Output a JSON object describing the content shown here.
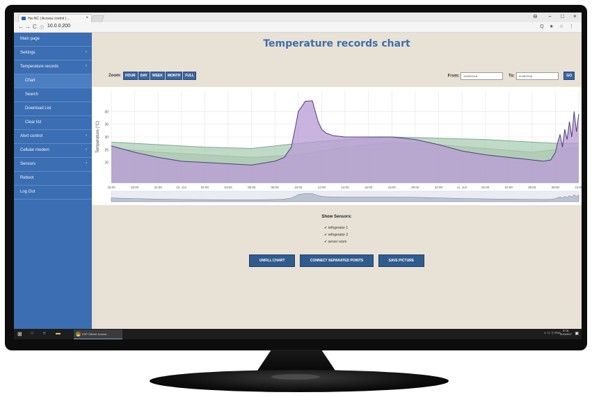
{
  "browser": {
    "tab_title": "Hw-NC | Access control | ...",
    "tab_close": "×",
    "url": "10.0.0.200",
    "nav": {
      "back": "←",
      "forward": "→",
      "reload": "C",
      "info": "ⓘ"
    },
    "window_controls": {
      "account": "⊖",
      "minimize": "−",
      "maximize": "□",
      "close": "×"
    },
    "addr_icons": "Q ★ ☆ ⋮"
  },
  "sidebar": {
    "items": [
      {
        "label": "Main page",
        "chevron": ""
      },
      {
        "label": "Settings",
        "chevron": "›"
      },
      {
        "label": "Temperature records",
        "chevron": "›"
      },
      {
        "label": "Chart",
        "chevron": ""
      },
      {
        "label": "Search",
        "chevron": ""
      },
      {
        "label": "Download List",
        "chevron": ""
      },
      {
        "label": "Clear list",
        "chevron": ""
      },
      {
        "label": "Alert control",
        "chevron": "›"
      },
      {
        "label": "Cellular modem",
        "chevron": "›"
      },
      {
        "label": "Sensors",
        "chevron": "›"
      },
      {
        "label": "Reboot",
        "chevron": ""
      },
      {
        "label": "Log Out",
        "chevron": ""
      }
    ]
  },
  "main": {
    "title": "Temperature records chart",
    "zoom_label": "Zoom:",
    "zoom_buttons": [
      "HOUR",
      "DAY",
      "WEEK",
      "MONTH",
      "FULL"
    ],
    "from_label": "From:",
    "from_value": "10/09/2018",
    "to_label": "To:",
    "to_value": "11/09/2018",
    "go_label": "GO",
    "show_sensors_label": "Show Sensors:",
    "sensors": [
      "refrigerator 1",
      "refrigerator 2",
      "server room"
    ],
    "check_mark": "✔",
    "buttons": [
      "UNFILL CHART",
      "CONNECT SEPARATED POINTS",
      "SAVE PICTURE"
    ]
  },
  "chart_data": {
    "type": "area",
    "ylabel": "Temperature (°C)",
    "ylim": [
      12,
      48
    ],
    "yticks": [
      20,
      25,
      30,
      35,
      40
    ],
    "x_ticks": [
      "18:00",
      "20:00",
      "22:00",
      "10. Jun",
      "02:00",
      "04:00",
      "06:00",
      "08:00",
      "10:00",
      "12:00",
      "14:00",
      "16:00",
      "18:00",
      "20:00",
      "22:00",
      "11. Jun",
      "02:00",
      "04:00",
      "06:00",
      "08:00",
      "10:00"
    ],
    "grid": true,
    "colors": {
      "refrigerator 1": "#b99ad6",
      "refrigerator 2": "#a9cfb4",
      "server room": "#b9b4a6"
    },
    "series": [
      {
        "name": "refrigerator 1",
        "color": "#b99ad6",
        "stroke": "#4a3f7d",
        "x": [
          0,
          1,
          2,
          3,
          4,
          5,
          6,
          7,
          7.4,
          7.7,
          7.9,
          8.0,
          8.3,
          8.6,
          8.85,
          9,
          9.2,
          9.5,
          10,
          11,
          12,
          13,
          14,
          15,
          16,
          17,
          18,
          18.5,
          18.8,
          19,
          19.1,
          19.2,
          19.3,
          19.4,
          19.5,
          19.6,
          19.7,
          19.8,
          19.9,
          20
        ],
        "values": [
          26.5,
          24,
          22,
          20.5,
          20,
          19.5,
          19,
          20.5,
          22,
          26,
          35,
          40,
          44,
          44.2,
          36,
          33,
          31.5,
          30.5,
          30,
          30,
          30,
          29,
          27,
          24.5,
          23,
          22,
          21,
          20.5,
          21,
          24,
          28,
          31,
          26,
          33,
          29,
          36,
          30,
          40,
          32,
          39
        ]
      },
      {
        "name": "refrigerator 2",
        "color": "#a9cfb4",
        "stroke": "#7fa88a",
        "x": [
          0,
          2,
          4,
          6,
          8,
          10,
          12,
          14,
          16,
          18,
          19,
          20
        ],
        "values": [
          28,
          27,
          26,
          25.5,
          27.5,
          29,
          30,
          29.5,
          29,
          28,
          27.5,
          27.5
        ]
      },
      {
        "name": "server room",
        "color": "#b9b4a6",
        "stroke": "#8d8877",
        "x": [
          0,
          2,
          4,
          6,
          8,
          10,
          12,
          14,
          16,
          18,
          19,
          20
        ],
        "values": [
          25.5,
          24,
          23,
          22,
          23,
          26,
          28,
          27,
          25.5,
          24,
          25,
          26
        ]
      }
    ]
  },
  "taskbar": {
    "app_label": "ESP Official Access...",
    "tray": "∧ 🗨 ⓔ ENG",
    "time": "07:31",
    "date": "21/11/2017",
    "notif": "▣"
  }
}
